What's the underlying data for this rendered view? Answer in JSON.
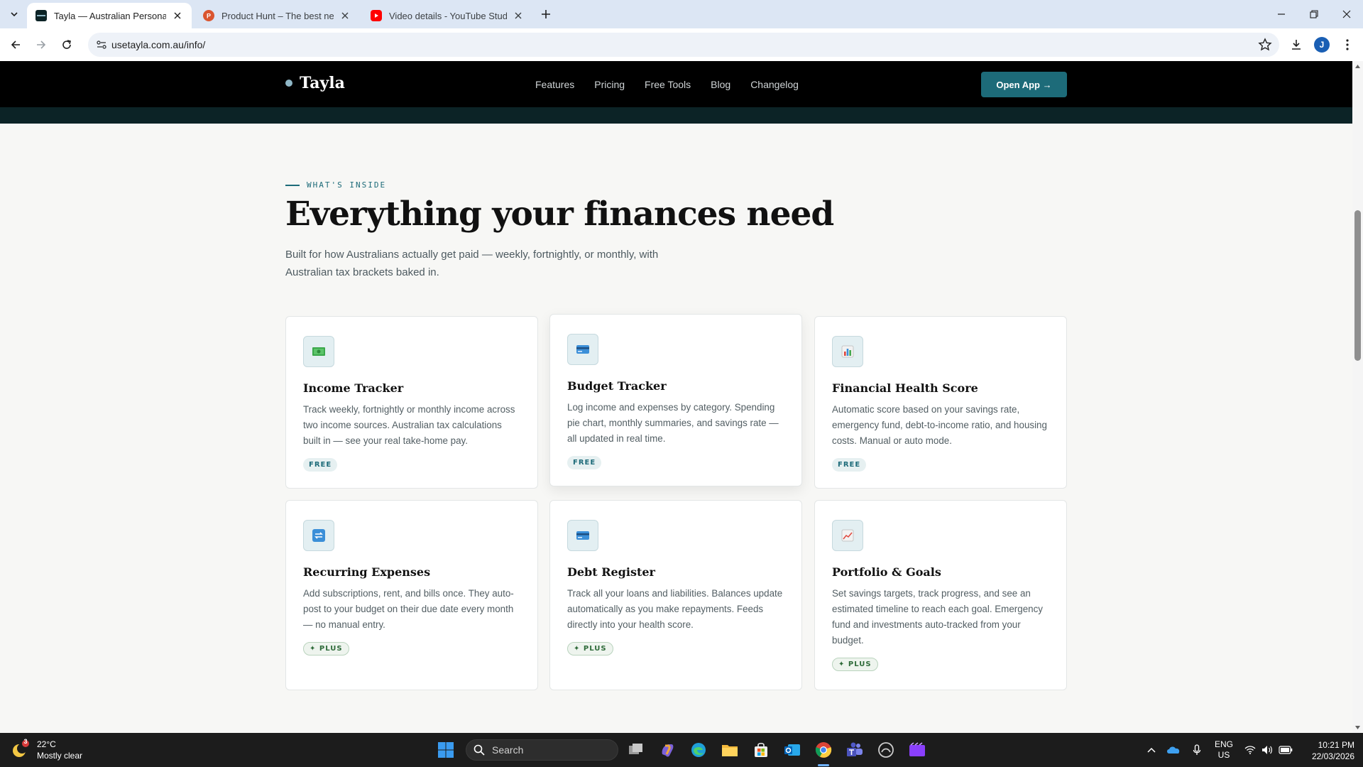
{
  "browser": {
    "tabs": [
      {
        "title": "Tayla — Australian Personal Fin",
        "favicon": "tayla-favicon",
        "active": true
      },
      {
        "title": "Product Hunt – The best new p",
        "favicon": "product-hunt-favicon",
        "active": false
      },
      {
        "title": "Video details - YouTube Studio",
        "favicon": "youtube-favicon",
        "active": false
      }
    ],
    "url": "usetayla.com.au/info/",
    "profile_initial": "J"
  },
  "site": {
    "brand": "Tayla",
    "nav": [
      "Features",
      "Pricing",
      "Free Tools",
      "Blog",
      "Changelog"
    ],
    "cta": "Open App →"
  },
  "section": {
    "eyebrow": "WHAT'S INSIDE",
    "title": "Everything your finances need",
    "subtitle": "Built for how Australians actually get paid — weekly, fortnightly, or monthly, with Australian tax brackets baked in."
  },
  "features": [
    {
      "title": "Income Tracker",
      "description": "Track weekly, fortnightly or monthly income across two income sources. Australian tax calculations built in — see your real take-home pay.",
      "badge": "FREE",
      "icon": "money-icon"
    },
    {
      "title": "Budget Tracker",
      "description": "Log income and expenses by category. Spending pie chart, monthly summaries, and savings rate — all updated in real time.",
      "badge": "FREE",
      "icon": "credit-card-icon"
    },
    {
      "title": "Financial Health Score",
      "description": "Automatic score based on your savings rate, emergency fund, debt-to-income ratio, and housing costs. Manual or auto mode.",
      "badge": "FREE",
      "icon": "bar-chart-icon"
    },
    {
      "title": "Recurring Expenses",
      "description": "Add subscriptions, rent, and bills once. They auto-post to your budget on their due date every month — no manual entry.",
      "badge": "✦ PLUS",
      "icon": "repeat-icon"
    },
    {
      "title": "Debt Register",
      "description": "Track all your loans and liabilities. Balances update automatically as you make repayments. Feeds directly into your health score.",
      "badge": "✦ PLUS",
      "icon": "credit-card-icon"
    },
    {
      "title": "Portfolio & Goals",
      "description": "Set savings targets, track progress, and see an estimated timeline to reach each goal. Emergency fund and investments auto-tracked from your budget.",
      "badge": "✦ PLUS",
      "icon": "trend-up-icon"
    }
  ],
  "taskbar": {
    "weather_temp": "22°C",
    "weather_desc": "Mostly clear",
    "weather_badge": "3",
    "search_placeholder": "Search",
    "lang": "ENG",
    "region": "US",
    "time": "10:21 PM",
    "date": "22/03/2026"
  },
  "colors": {
    "accent": "#1d6b79",
    "nav_bg": "#000000",
    "page_bg": "#f7f7f5"
  }
}
